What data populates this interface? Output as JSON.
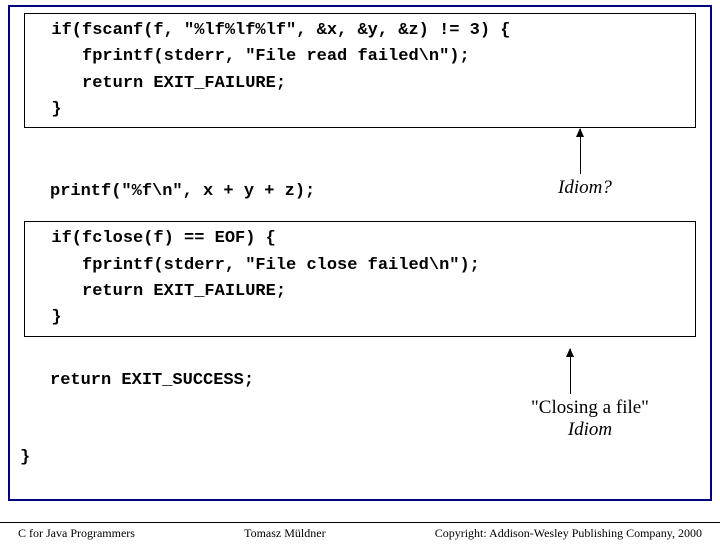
{
  "box1": {
    "l1": "  if(fscanf(f, \"%lf%lf%lf\", &x, &y, &z) != 3) {",
    "l2": "     fprintf(stderr, \"File read failed\\n\");",
    "l3": "     return EXIT_FAILURE;",
    "l4": "  }"
  },
  "annotation1": "Idiom?",
  "mid": {
    "l1": "printf(\"%f\\n\", x + y + z);"
  },
  "box2": {
    "l1": "  if(fclose(f) == EOF) {",
    "l2": "     fprintf(stderr, \"File close failed\\n\");",
    "l3": "     return EXIT_FAILURE;",
    "l4": "  }"
  },
  "annotation2_line1": "\"Closing a file\"",
  "annotation2_line2": "Idiom",
  "tail": {
    "l1": "return EXIT_SUCCESS;"
  },
  "close_brace": "}",
  "footer": {
    "left": "C for Java Programmers",
    "center": "Tomasz Müldner",
    "right": "Copyright: Addison-Wesley Publishing Company, 2000"
  }
}
